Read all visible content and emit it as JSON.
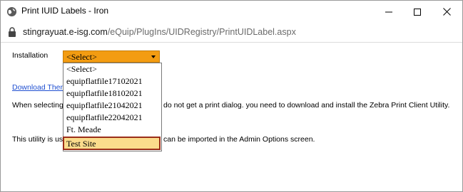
{
  "window": {
    "title": "Print IUID Labels - Iron",
    "icon": "globe-icon",
    "controls": [
      "minimize-icon",
      "maximize-icon",
      "close-icon"
    ]
  },
  "address": {
    "host": "stingrayuat.e-isg.com",
    "path": "/eQuip/PlugIns/UIDRegistry/PrintUIDLabel.aspx",
    "icon": "lock-icon"
  },
  "form": {
    "installation_label": "Installation",
    "select_value": "<Select>",
    "options": [
      "<Select>",
      "equipflatfile17102021",
      "equipflatfile18102021",
      "equipflatfile21042021",
      "equipflatfile22042021",
      "Ft. Meade",
      "Test Site"
    ],
    "highlighted_option": "Test Site"
  },
  "body": {
    "download_link": "Download Ther",
    "line1_left": "When selecting",
    "line1_right": "do not get a print dialog. you need to download and install the Zebra Print Client Utility.",
    "line2_left": "This utility is us",
    "line2_right": "can be imported in the Admin Options screen."
  },
  "colors": {
    "select_bg": "#f39c12",
    "highlight_bg": "#fbdc8c",
    "highlight_border": "#9a2d18",
    "link": "#1f4fd1"
  }
}
